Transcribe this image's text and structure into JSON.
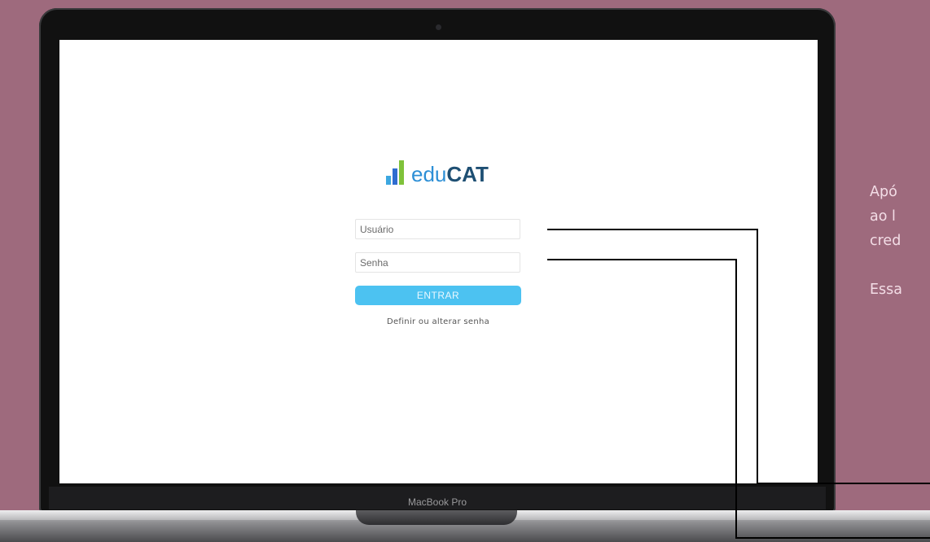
{
  "login": {
    "logo_prefix": "edu",
    "logo_suffix": "CAT",
    "username_placeholder": "Usuário",
    "password_placeholder": "Senha",
    "submit_label": "ENTRAR",
    "reset_link": "Definir ou alterar senha"
  },
  "laptop": {
    "brand_label": "MacBook Pro"
  },
  "side_text": {
    "line1": "Apó",
    "line2": "ao l",
    "line3": "cred",
    "line4": "Essa"
  },
  "colors": {
    "background": "#9e6a7d",
    "button": "#4cc2f1",
    "logo_blue": "#2d8fd6",
    "logo_dark": "#1e4f73",
    "logo_green": "#7fc23a"
  },
  "icons": {
    "logo": "bar-chart-icon",
    "camera": "camera-icon"
  }
}
